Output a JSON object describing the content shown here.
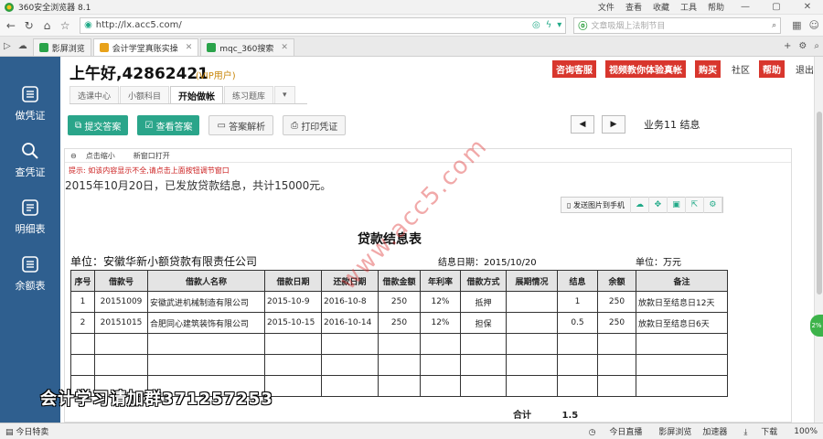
{
  "browser": {
    "window_title": "360安全浏览器 8.1",
    "menu": [
      "文件",
      "查看",
      "收藏",
      "工具",
      "帮助"
    ],
    "url": "http://lx.acc5.com/",
    "search_placeholder": "文章吸烟上法制节目",
    "tabs": [
      {
        "label": "影屏浏览",
        "active": false,
        "color": "#2aa34a"
      },
      {
        "label": "会计学堂真账实操",
        "active": true,
        "color": "#e8a21b"
      },
      {
        "label": "mqc_360搜索",
        "active": false,
        "color": "#2aa34a"
      }
    ],
    "status": {
      "left": "今日特卖",
      "items": [
        "今日直播",
        "影屏浏览",
        "加速器",
        "下载",
        "100%"
      ]
    }
  },
  "sidebar": {
    "items": [
      {
        "label": "做凭证",
        "icon": "voucher-icon"
      },
      {
        "label": "查凭证",
        "icon": "search-icon"
      },
      {
        "label": "明细表",
        "icon": "list-icon"
      },
      {
        "label": "余额表",
        "icon": "balance-icon"
      }
    ]
  },
  "header": {
    "greeting": "上午好,42862421",
    "vip": "(VIP用户)",
    "red_buttons": [
      "咨询客服",
      "视频教你体验真帐",
      "购买",
      "帮助"
    ],
    "links": [
      "社区",
      "退出"
    ],
    "subtabs": [
      {
        "label": "选课中心",
        "active": false
      },
      {
        "label": "小额科目",
        "active": false
      },
      {
        "label": "开始做帐",
        "active": true
      },
      {
        "label": "练习题库",
        "active": false
      }
    ]
  },
  "actions": {
    "submit": "提交答案",
    "view": "查看答案",
    "analysis": "答案解析",
    "print": "打印凭证",
    "business": "业务11 结息"
  },
  "doc": {
    "tool_zoom": "点击缩小",
    "tool_window": "新窗口打开",
    "hint": "提示: 如该内容显示不全,请点击上面按钮调节窗口",
    "notice": "2015年10月20日，已发放贷款结息，共计15000元。",
    "send_to_phone": "发送图片到手机",
    "title": "贷款结息表",
    "company": "单位：安徽华新小额贷款有限责任公司",
    "date_label": "结息日期：2015/10/20",
    "unit_label": "单位：万元",
    "watermark": "www.acc5.com",
    "promo": "会计学习请加群371257253"
  },
  "table": {
    "headers": [
      "序号",
      "借款号",
      "借款人名称",
      "借款日期",
      "还款日期",
      "借款金额",
      "年利率",
      "借款方式",
      "展期情况",
      "结息",
      "余额",
      "备注"
    ],
    "rows": [
      [
        "1",
        "20151009",
        "安徽武进机械制造有限公司",
        "2015-10-9",
        "2016-10-8",
        "250",
        "12%",
        "抵押",
        "",
        "1",
        "250",
        "放款日至结息日12天"
      ],
      [
        "2",
        "20151015",
        "合肥同心建筑装饰有限公司",
        "2015-10-15",
        "2016-10-14",
        "250",
        "12%",
        "担保",
        "",
        "0.5",
        "250",
        "放款日至结息日6天"
      ]
    ],
    "total_label": "合计",
    "total_value": "1.5"
  }
}
